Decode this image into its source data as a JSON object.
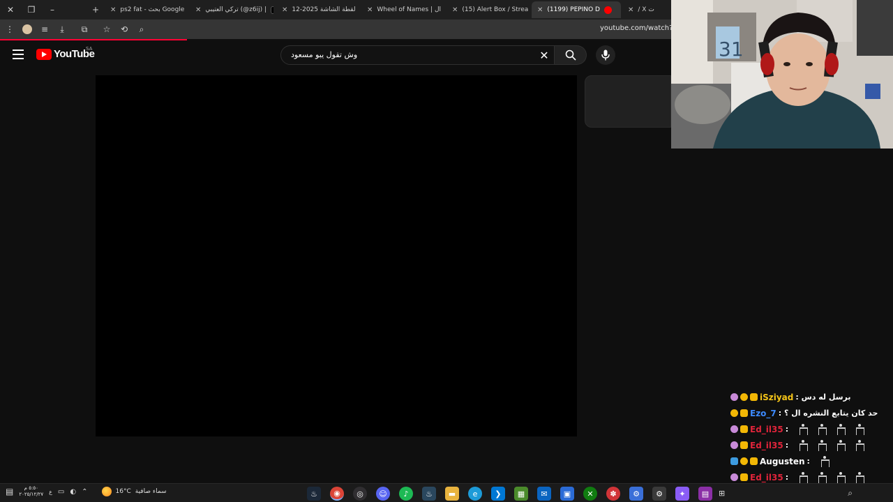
{
  "browser": {
    "tabs": [
      {
        "title": "ps2 fat - بحث Google",
        "favicon": "google-icon",
        "color": "#ffffff"
      },
      {
        "title": "تركي العتيبي (@z6ij) |",
        "favicon": "tiktok-icon",
        "color": "#000000"
      },
      {
        "title": "لقطة الشاشة 2025-12",
        "favicon": "image-icon",
        "color": "#666666"
      },
      {
        "title": "Wheel of Names | ال",
        "favicon": "wheel-icon",
        "color": "#4a8cff"
      },
      {
        "title": "(15) Alert Box / Strea",
        "favicon": "streamlabs-icon",
        "color": "#31c3a2"
      },
      {
        "title": "(1199) PEPINO D",
        "favicon": "youtube-icon",
        "color": "#ff0000"
      },
      {
        "title": "/ X ت",
        "favicon": "x-icon",
        "color": "#000000"
      }
    ],
    "url": "youtube.com/watch?v=F"
  },
  "youtube": {
    "logo_text": "YouTube",
    "region": "SA",
    "search_query": "وش تقول يبو مسعود"
  },
  "chat": [
    {
      "user": "iSziyad",
      "user_color": "#f5c518",
      "message": "برسل له دس :",
      "badges": [
        "#c88ad8",
        "#f2b705",
        "#f2b705"
      ]
    },
    {
      "user": "Ezo_7",
      "user_color": "#3d8bff",
      "message": "حد كان يتابع النشره ال ؟ :",
      "badges": [
        "#f2b705",
        "#f2b705"
      ]
    },
    {
      "user": "Ed_il35",
      "user_color": "#e0243a",
      "message": ":",
      "badges": [
        "#c88ad8",
        "#f2b705"
      ],
      "emotes": 4
    },
    {
      "user": "Ed_il35",
      "user_color": "#e0243a",
      "message": ":",
      "badges": [
        "#c88ad8",
        "#f2b705"
      ],
      "emotes": 4
    },
    {
      "user": "Augusten",
      "user_color": "#ffffff",
      "message": ":",
      "badges": [
        "#3d9be0",
        "#f2b705",
        "#f2b705"
      ],
      "emotes": 1
    },
    {
      "user": "Ed_il35",
      "user_color": "#e0243a",
      "message": ":",
      "badges": [
        "#c88ad8",
        "#f2b705"
      ],
      "emotes": 4
    }
  ],
  "taskbar": {
    "time": "٥:٥٠ م",
    "date": "٢٠٢٥/١٢/٢٧",
    "lang": "ع",
    "temperature": "16°C",
    "weather_text": "سماء صافية",
    "apps": [
      {
        "name": "steam-icon",
        "color": "#1b2838",
        "glyph": "♨"
      },
      {
        "name": "chrome-icon",
        "color": "#db4437",
        "glyph": "◉"
      },
      {
        "name": "obs-icon",
        "color": "#302e31",
        "glyph": "◎"
      },
      {
        "name": "discord-icon",
        "color": "#5865f2",
        "glyph": "☺"
      },
      {
        "name": "spotify-icon",
        "color": "#1db954",
        "glyph": "♪"
      },
      {
        "name": "steam2-icon",
        "color": "#2a475e",
        "glyph": "♨"
      },
      {
        "name": "folder-icon",
        "color": "#e8b33e",
        "glyph": "▬"
      },
      {
        "name": "edge-icon",
        "color": "#1d9bd8",
        "glyph": "e"
      },
      {
        "name": "vscode-icon",
        "color": "#0078d4",
        "glyph": "❯"
      },
      {
        "name": "minecraft-icon",
        "color": "#4b8b2b",
        "glyph": "▦"
      },
      {
        "name": "outlook-icon",
        "color": "#0a64c0",
        "glyph": "✉"
      },
      {
        "name": "store-icon",
        "color": "#2b6bd6",
        "glyph": "▣"
      },
      {
        "name": "xbox-icon",
        "color": "#107c10",
        "glyph": "✕"
      },
      {
        "name": "app-red-icon",
        "color": "#d13438",
        "glyph": "✽"
      },
      {
        "name": "app-blue-icon",
        "color": "#3a6fd8",
        "glyph": "⚙"
      },
      {
        "name": "settings-icon",
        "color": "#3a3a3a",
        "glyph": "⚙"
      },
      {
        "name": "copilot-icon",
        "color": "#8a5cf6",
        "glyph": "✦"
      },
      {
        "name": "winrar-icon",
        "color": "#8b2fa6",
        "glyph": "▤"
      }
    ]
  }
}
